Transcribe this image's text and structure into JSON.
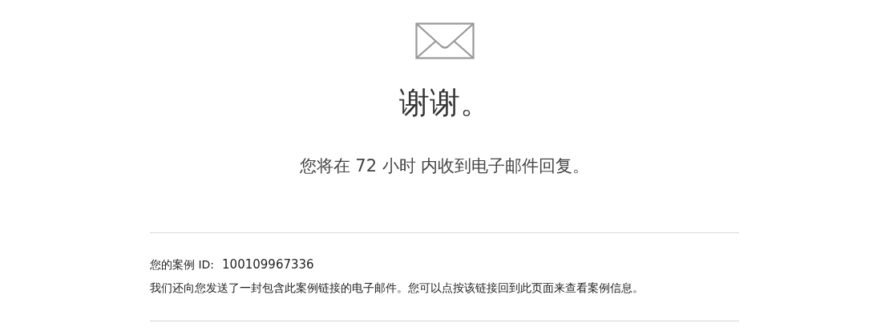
{
  "title": "谢谢。",
  "message": "您将在 72 小时 内收到电子邮件回复。",
  "case": {
    "label": "您的案例 ID:",
    "id": "100109967336"
  },
  "note": "我们还向您发送了一封包含此案例链接的电子邮件。您可以点按该链接回到此页面来查看案例信息。"
}
